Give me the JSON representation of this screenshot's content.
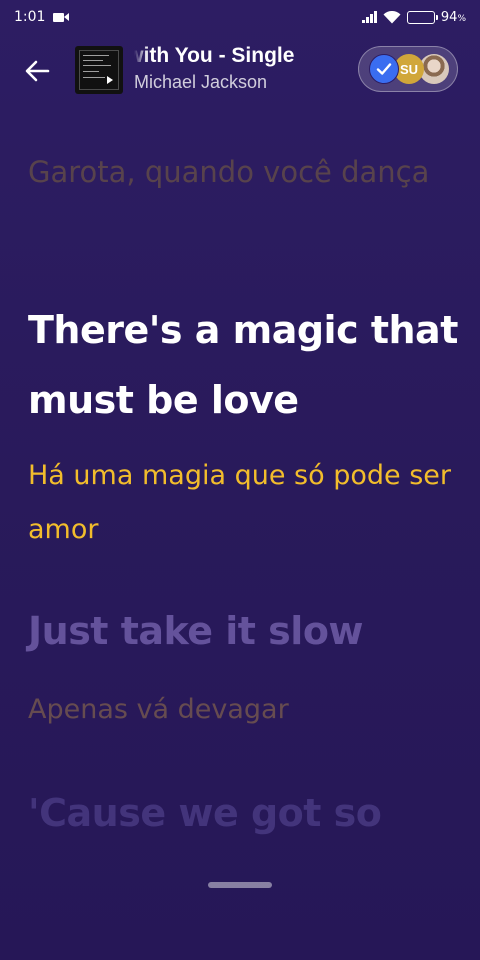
{
  "status_bar": {
    "time": "1:01",
    "battery_percent": "94",
    "battery_unit": "%",
    "icons": [
      "video-camera-icon",
      "signal-icon",
      "wifi-icon",
      "battery-icon"
    ]
  },
  "header": {
    "back_icon": "arrow-left-icon",
    "track_title": "Rock with You - Single",
    "artist": "Michael Jackson",
    "participants": [
      {
        "type": "check",
        "icon": "check-icon"
      },
      {
        "type": "initials",
        "label": "SU"
      },
      {
        "type": "photo"
      }
    ]
  },
  "lyrics": {
    "past_translation": "Garota, quando você dança",
    "current_line": "There's a magic that must be love",
    "current_translation": "Há uma magia que só pode ser amor",
    "next_line": "Just take it slow",
    "next_translation": "Apenas vá devagar",
    "future_line": "'Cause we got so"
  },
  "colors": {
    "background": "#2a1b5c",
    "current_line": "#ffffff",
    "translation_highlight": "#f2bd2c",
    "avatar_check": "#3a6df0",
    "avatar_su": "#d1a73a"
  }
}
